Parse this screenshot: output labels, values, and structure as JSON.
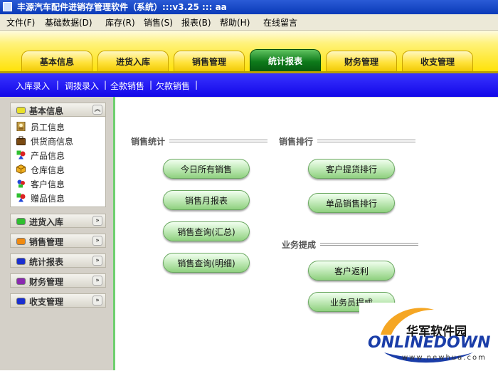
{
  "window": {
    "title": "丰源汽车配件进销存管理软件（系统）:::v3.25 ::: aa"
  },
  "menu": [
    "文件(F)",
    "基础数据(D)",
    "库存(R)",
    "销售(S)",
    "报表(B)",
    "帮助(H)",
    "在线留言"
  ],
  "tabs": [
    {
      "label": "基本信息",
      "active": false
    },
    {
      "label": "进货入库",
      "active": false
    },
    {
      "label": "销售管理",
      "active": false
    },
    {
      "label": "统计报表",
      "active": true
    },
    {
      "label": "财务管理",
      "active": false
    },
    {
      "label": "收支管理",
      "active": false
    }
  ],
  "subtoolbar": [
    "入库录入",
    "调拨录入",
    "全款销售",
    "欠款销售"
  ],
  "subtoolbar_sep": "|",
  "sidebar": {
    "expanded_section": {
      "title": "基本信息",
      "items": [
        "员工信息",
        "供货商信息",
        "产品信息",
        "仓库信息",
        "客户信息",
        "赠品信息"
      ]
    },
    "sections": [
      "进货入库",
      "销售管理",
      "统计报表",
      "财务管理",
      "收支管理"
    ],
    "colors": {
      "yellow": "#e8e02a",
      "green": "#2fbf2f",
      "orange": "#f08a10",
      "blue": "#1a2fd0",
      "purple": "#8a2ab0"
    },
    "chevron": "»"
  },
  "main": {
    "sales_stats": {
      "label": "销售统计",
      "buttons": [
        "今日所有销售",
        "销售月报表",
        "销售查询(汇总)",
        "销售查询(明细)"
      ]
    },
    "sales_rank": {
      "label": "销售排行",
      "buttons": [
        "客户提货排行",
        "单品销售排行"
      ]
    },
    "commission": {
      "label": "业务提成",
      "buttons": [
        "客户返利",
        "业务员提成"
      ]
    }
  },
  "watermark": {
    "cn": "华军软件园",
    "en": "ONLINEDOWN",
    "url": "www.newhua.com"
  }
}
